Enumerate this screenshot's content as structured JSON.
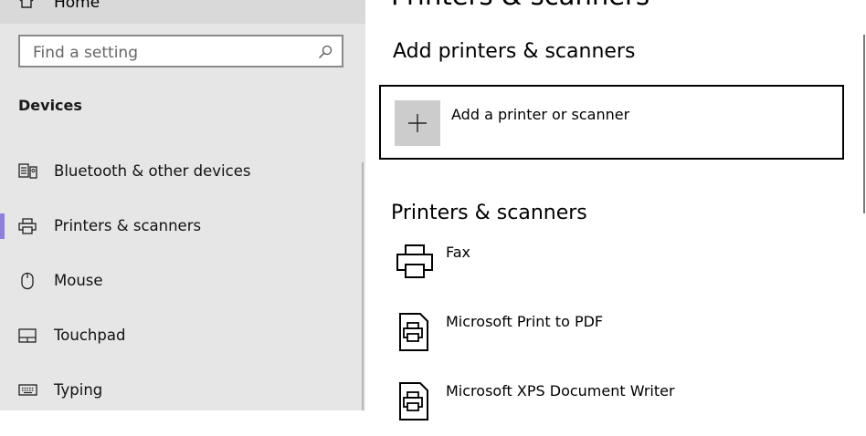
{
  "sidebar": {
    "home_label": "Home",
    "search": {
      "placeholder": "Find a setting"
    },
    "section_heading": "Devices",
    "items": [
      {
        "label": "Bluetooth & other devices",
        "icon": "bluetooth-devices-icon"
      },
      {
        "label": "Printers & scanners",
        "icon": "printer-icon",
        "selected": true
      },
      {
        "label": "Mouse",
        "icon": "mouse-icon"
      },
      {
        "label": "Touchpad",
        "icon": "touchpad-icon"
      },
      {
        "label": "Typing",
        "icon": "keyboard-icon"
      }
    ]
  },
  "main": {
    "page_title": "Printers & scanners",
    "add_section_heading": "Add printers & scanners",
    "add_button_label": "Add a printer or scanner",
    "printers_heading": "Printers & scanners",
    "printers": [
      {
        "name": "Fax",
        "icon": "fax-printer-icon"
      },
      {
        "name": "Microsoft Print to PDF",
        "icon": "document-printer-icon"
      },
      {
        "name": "Microsoft XPS Document Writer",
        "icon": "document-printer-icon"
      }
    ]
  },
  "colors": {
    "sidebar_bg": "#e6e6e6",
    "selected_indicator": "#8f7fde",
    "add_tile_bg": "#cccccc"
  }
}
